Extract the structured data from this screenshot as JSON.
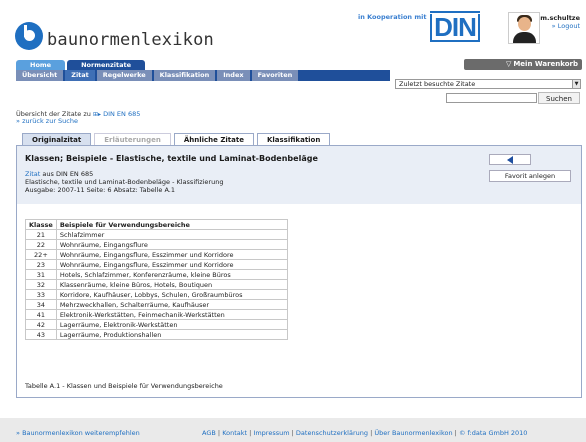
{
  "header": {
    "logo_text": "baunormenlexikon",
    "coop_text": "in Kooperation mit",
    "din_logo": "DIN",
    "user_name": "m.schultze",
    "logout_label": "Logout",
    "logout_prefix": "»"
  },
  "nav_top": {
    "home": "Home",
    "normenzitate": "Normenzitate",
    "cart": "Mein Warenkorb"
  },
  "nav_sub": {
    "items": [
      "Übersicht",
      "Zitat",
      "Regelwerke",
      "Klassifikation",
      "Index",
      "Favoriten"
    ]
  },
  "recent": {
    "selected": "Zuletzt besuchte Zitate"
  },
  "search": {
    "button": "Suchen",
    "value": ""
  },
  "breadcrumb": {
    "text": "Übersicht der Zitate zu",
    "doc": "DIN EN 685",
    "back": "zurück zur Suche"
  },
  "content_tabs": [
    "Originalzitat",
    "Erläuterungen",
    "Ähnliche Zitate",
    "Klassifikation"
  ],
  "citation": {
    "title": "Klassen; Beispiele - Elastische, textile und Laminat-Bodenbeläge",
    "line1_link": "Zitat",
    "line1_rest": " aus DIN EN 685",
    "line2": "Elastische, textile und Laminat-Bodenbeläge - Klassifizierung",
    "line3": "Ausgabe: 2007-11 Seite: 6 Absatz: Tabelle A.1",
    "fav_button": "Favorit anlegen"
  },
  "table": {
    "headers": [
      "Klasse",
      "Beispiele für Verwendungsbereiche"
    ],
    "rows": [
      [
        "21",
        "Schlafzimmer"
      ],
      [
        "22",
        "Wohnräume, Eingangsflure"
      ],
      [
        "22+",
        "Wohnräume, Eingangsflure, Esszimmer und Korridore"
      ],
      [
        "23",
        "Wohnräume, Eingangsflure, Esszimmer und Korridore"
      ],
      [
        "31",
        "Hotels, Schlafzimmer, Konferenzräume, kleine Büros"
      ],
      [
        "32",
        "Klassenräume, kleine Büros, Hotels, Boutiquen"
      ],
      [
        "33",
        "Korridore, Kaufhäuser, Lobbys, Schulen, Großraumbüros"
      ],
      [
        "34",
        "Mehrzweckhallen, Schalterräume, Kaufhäuser"
      ],
      [
        "41",
        "Elektronik-Werkstätten, Feinmechanik-Werkstätten"
      ],
      [
        "42",
        "Lagerräume, Elektronik-Werkstätten"
      ],
      [
        "43",
        "Lagerräume, Produktionshallen"
      ]
    ],
    "caption": "Tabelle A.1 - Klassen und Beispiele für Verwendungsbereiche"
  },
  "footer": {
    "recommend": "Baunormenlexikon weiterempfehlen",
    "links": [
      "AGB",
      "Kontakt",
      "Impressum",
      "Datenschutzerklärung",
      "Über Baunormenlexikon",
      "© f:data GmbH 2010"
    ]
  }
}
